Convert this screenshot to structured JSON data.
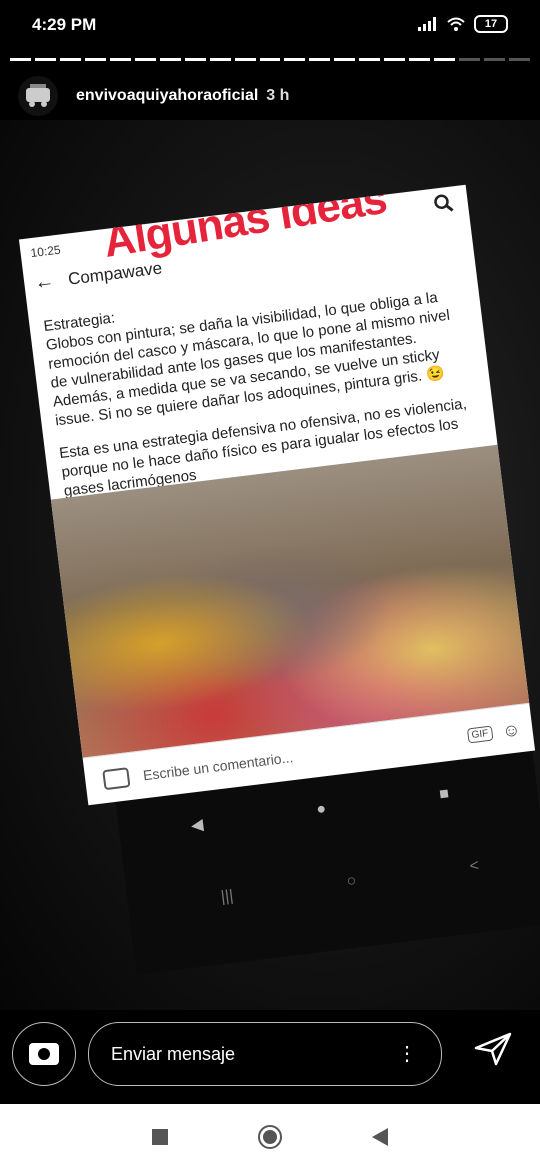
{
  "status_bar": {
    "time": "4:29 PM",
    "battery": "17"
  },
  "story": {
    "username": "envivoaquiyahoraoficial",
    "age": "3 h"
  },
  "screenshot": {
    "time": "10:25",
    "title": "Compawave",
    "sticker_text": "Algunas ideas",
    "paragraph1": "Estrategia:\nGlobos con pintura; se daña la visibilidad, lo que obliga a la remoción del casco y  máscara, lo que lo pone al mismo nivel de vulnerabilidad ante los gases que los manifestantes. Además, a medida que se va secando, se vuelve un sticky issue. Si no se quiere dañar los adoquines, pintura gris. 😉",
    "paragraph2": "Esta es una estrategia defensiva no ofensiva, no es violencia, porque no le hace daño físico es para igualar los efectos los gases lacrimógenos",
    "comment_placeholder": "Escribe un comentario...",
    "gif_label": "GIF"
  },
  "reply": {
    "placeholder": "Enviar mensaje"
  },
  "icons": {
    "camera": "camera-icon",
    "send": "send-icon",
    "more": "more-vertical-icon",
    "search": "search-icon"
  }
}
